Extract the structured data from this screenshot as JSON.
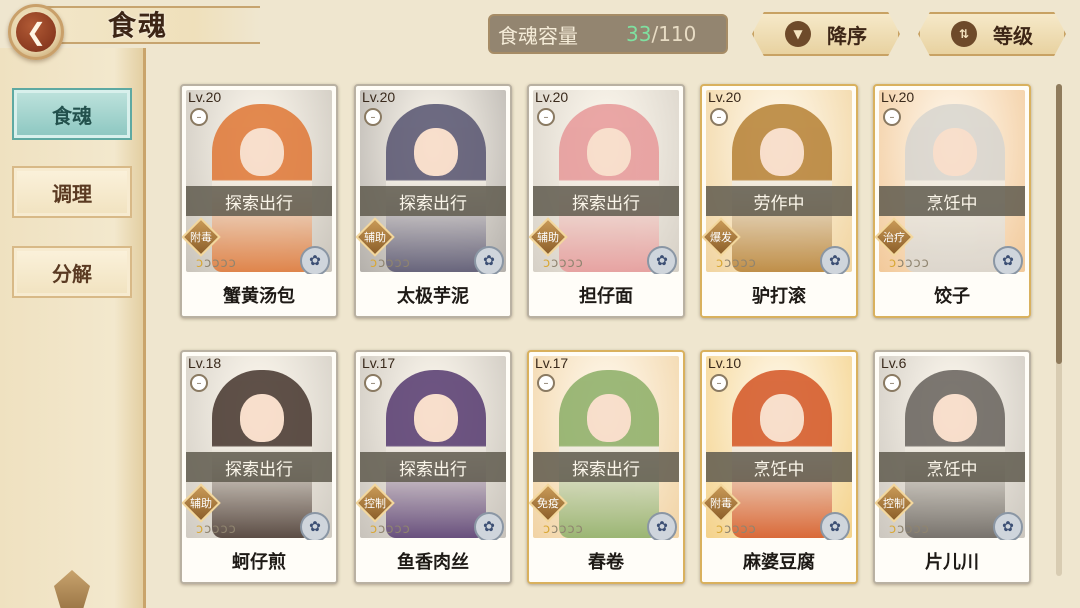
{
  "header": {
    "title": "食魂",
    "back_icon": "chevron-left-icon"
  },
  "sidebar": {
    "tabs": [
      {
        "label": "食魂",
        "active": true
      },
      {
        "label": "调理",
        "active": false
      },
      {
        "label": "分解",
        "active": false
      }
    ]
  },
  "toolbar": {
    "capacity_label": "食魂容量",
    "capacity_current": "33",
    "capacity_separator": "/",
    "capacity_max": "110",
    "sort_order_label": "降序",
    "sort_order_icon": "triangle-down-icon",
    "sort_key_label": "等级",
    "sort_key_icon": "sort-arrows-icon"
  },
  "cards": [
    {
      "level": "Lv.20",
      "status": "探索出行",
      "role": "附毒",
      "name": "蟹黄汤包",
      "stars": 1,
      "theme": "#c9c4bb",
      "accent": "#e07a3a"
    },
    {
      "level": "Lv.20",
      "status": "探索出行",
      "role": "辅助",
      "name": "太极芋泥",
      "stars": 1,
      "theme": "#b4b0ab",
      "accent": "#5b5873"
    },
    {
      "level": "Lv.20",
      "status": "探索出行",
      "role": "辅助",
      "name": "担仔面",
      "stars": 1,
      "theme": "#d6d0c6",
      "accent": "#e79b9b"
    },
    {
      "level": "Lv.20",
      "status": "劳作中",
      "role": "爆发",
      "name": "驴打滚",
      "stars": 1,
      "theme": "#f1d49f",
      "accent": "#b8843a"
    },
    {
      "level": "Lv.20",
      "status": "烹饪中",
      "role": "治疗",
      "name": "饺子",
      "stars": 1,
      "theme": "#f2c99a",
      "accent": "#d9d6d0"
    },
    {
      "level": "Lv.18",
      "status": "探索出行",
      "role": "辅助",
      "name": "蚵仔煎",
      "stars": 1,
      "theme": "#d0cbc2",
      "accent": "#4a3a32"
    },
    {
      "level": "Lv.17",
      "status": "探索出行",
      "role": "控制",
      "name": "鱼香肉丝",
      "stars": 1,
      "theme": "#c8c3bb",
      "accent": "#5a3f73"
    },
    {
      "level": "Lv.17",
      "status": "探索出行",
      "role": "免疫",
      "name": "春卷",
      "stars": 1,
      "theme": "#f1d3a4",
      "accent": "#8fb06a"
    },
    {
      "level": "Lv.10",
      "status": "烹饪中",
      "role": "附毒",
      "name": "麻婆豆腐",
      "stars": 1,
      "theme": "#f4d28a",
      "accent": "#d55a2a"
    },
    {
      "level": "Lv.6",
      "status": "烹饪中",
      "role": "控制",
      "name": "片儿川",
      "stars": 1,
      "theme": "#ccc7bf",
      "accent": "#6b6660"
    }
  ],
  "colors": {
    "status_overlay": "#5f5a4e",
    "active_tab": "#8bc6c0",
    "capacity_current": "#7fe0a0"
  },
  "icons": {
    "element": "flower-icon",
    "mini": "round-badge-icon",
    "star": "flame-star-icon"
  }
}
